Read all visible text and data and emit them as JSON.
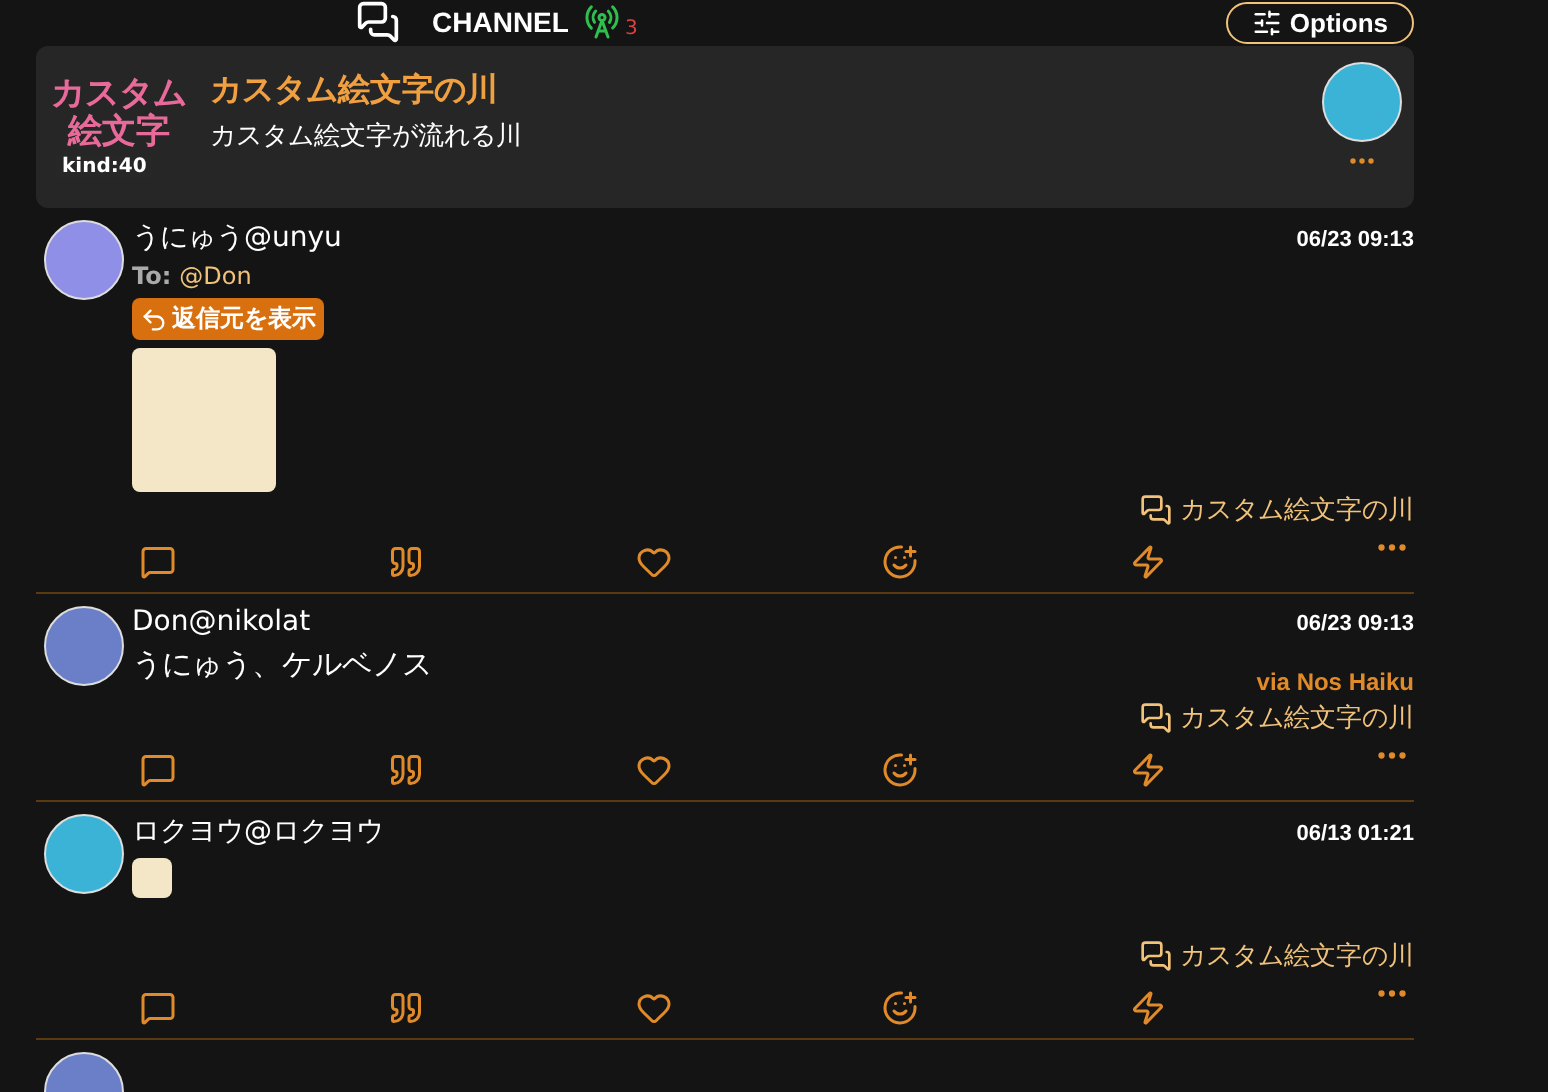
{
  "header": {
    "title": "CHANNEL",
    "relay_count": "3",
    "options_label": "Options"
  },
  "channel": {
    "picture_text": "カスタム絵文字",
    "kind_badge": "kind:40",
    "name": "カスタム絵文字の川",
    "about": "カスタム絵文字が流れる川"
  },
  "posts": [
    {
      "name": "うにゅう",
      "handle": "@unyu",
      "time": "06/23 09:13",
      "to_label": "To:",
      "to": "@Don",
      "reply_button": "返信元を表示",
      "content": {
        "kind": "sticker"
      },
      "channel": "カスタム絵文字の川"
    },
    {
      "name": "Don",
      "handle": "@nikolat",
      "time": "06/23 09:13",
      "content": {
        "kind": "text",
        "text": "うにゅう、ケルベノス"
      },
      "via": "via Nos Haiku",
      "channel": "カスタム絵文字の川"
    },
    {
      "name": "ロクヨウ",
      "handle": "@ロクヨウ",
      "time": "06/13 01:21",
      "content": {
        "kind": "emoji"
      },
      "channel": "カスタム絵文字の川"
    }
  ]
}
